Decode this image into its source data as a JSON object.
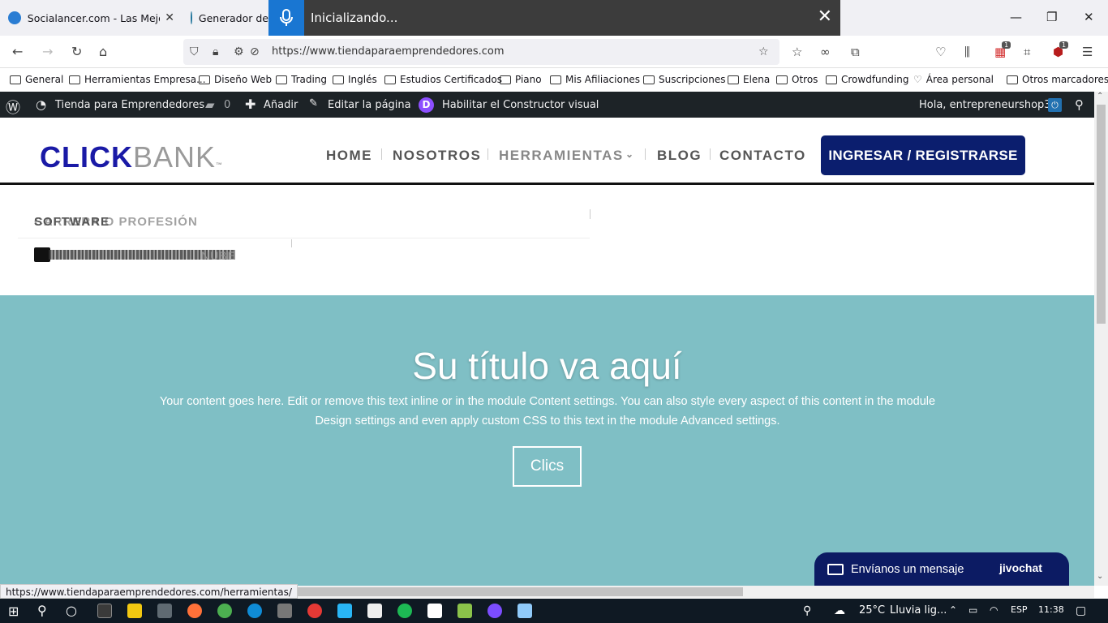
{
  "browser": {
    "tabs": [
      {
        "title": "Socialancer.com - Las Mejores H",
        "favicon_color": "#2a7dd3"
      },
      {
        "title": "Generador de",
        "favicon_color": "#21759b"
      }
    ],
    "voice_overlay": {
      "status": "Inicializando..."
    },
    "url": "https://www.tiendaparaemprendedores.com",
    "status_url": "https://www.tiendaparaemprendedores.com/herramientas/",
    "badges": {
      "addon1": "1",
      "addon2": "1"
    },
    "bookmarks": [
      "General",
      "Herramientas Empresa...",
      "Diseño Web",
      "Trading",
      "Inglés",
      "Estudios Certificados",
      "Piano",
      "Mis Afiliaciones",
      "Suscripciones",
      "Elena",
      "Otros",
      "Crowdfunding",
      "Área personal",
      "Otros marcadores"
    ]
  },
  "wp_admin_bar": {
    "site_name": "Tienda para Emprendedores",
    "comments_count": "0",
    "add_new": "Añadir",
    "edit_page": "Editar la página",
    "divi_builder": "Habilitar el Constructor visual",
    "greeting": "Hola, entrepreneurshop33",
    "divi_letter": "D"
  },
  "site": {
    "logo_click": "CLICK",
    "logo_bank": "BANK",
    "logo_tm": "™",
    "menu": [
      {
        "label": "HOME"
      },
      {
        "label": "NOSOTROS"
      },
      {
        "label": "HERRAMIENTAS"
      },
      {
        "label": "BLOG"
      },
      {
        "label": "CONTACTO"
      }
    ],
    "cta": "INGRESAR / REGISTRARSE",
    "brand_color": "#0b1e6e"
  },
  "dropdown": {
    "heading_a": "SOFTWARE",
    "heading_b": "CARRERA O PROFESIÓN",
    "item_tail": "NUBE"
  },
  "hero": {
    "title": "Su título va aquí",
    "body": "Your content goes here. Edit or remove this text inline or in the module Content settings. You can also style every aspect of this content in the module Design settings and even apply custom CSS to this text in the module Advanced settings.",
    "button": "Clics",
    "background": "#7fbfc5"
  },
  "chat": {
    "label": "Envíanos un mensaje",
    "brand": "jivochat"
  },
  "taskbar": {
    "temperature": "25°C",
    "weather": "Lluvia lig...",
    "language": "ESP",
    "time": "11:38"
  }
}
